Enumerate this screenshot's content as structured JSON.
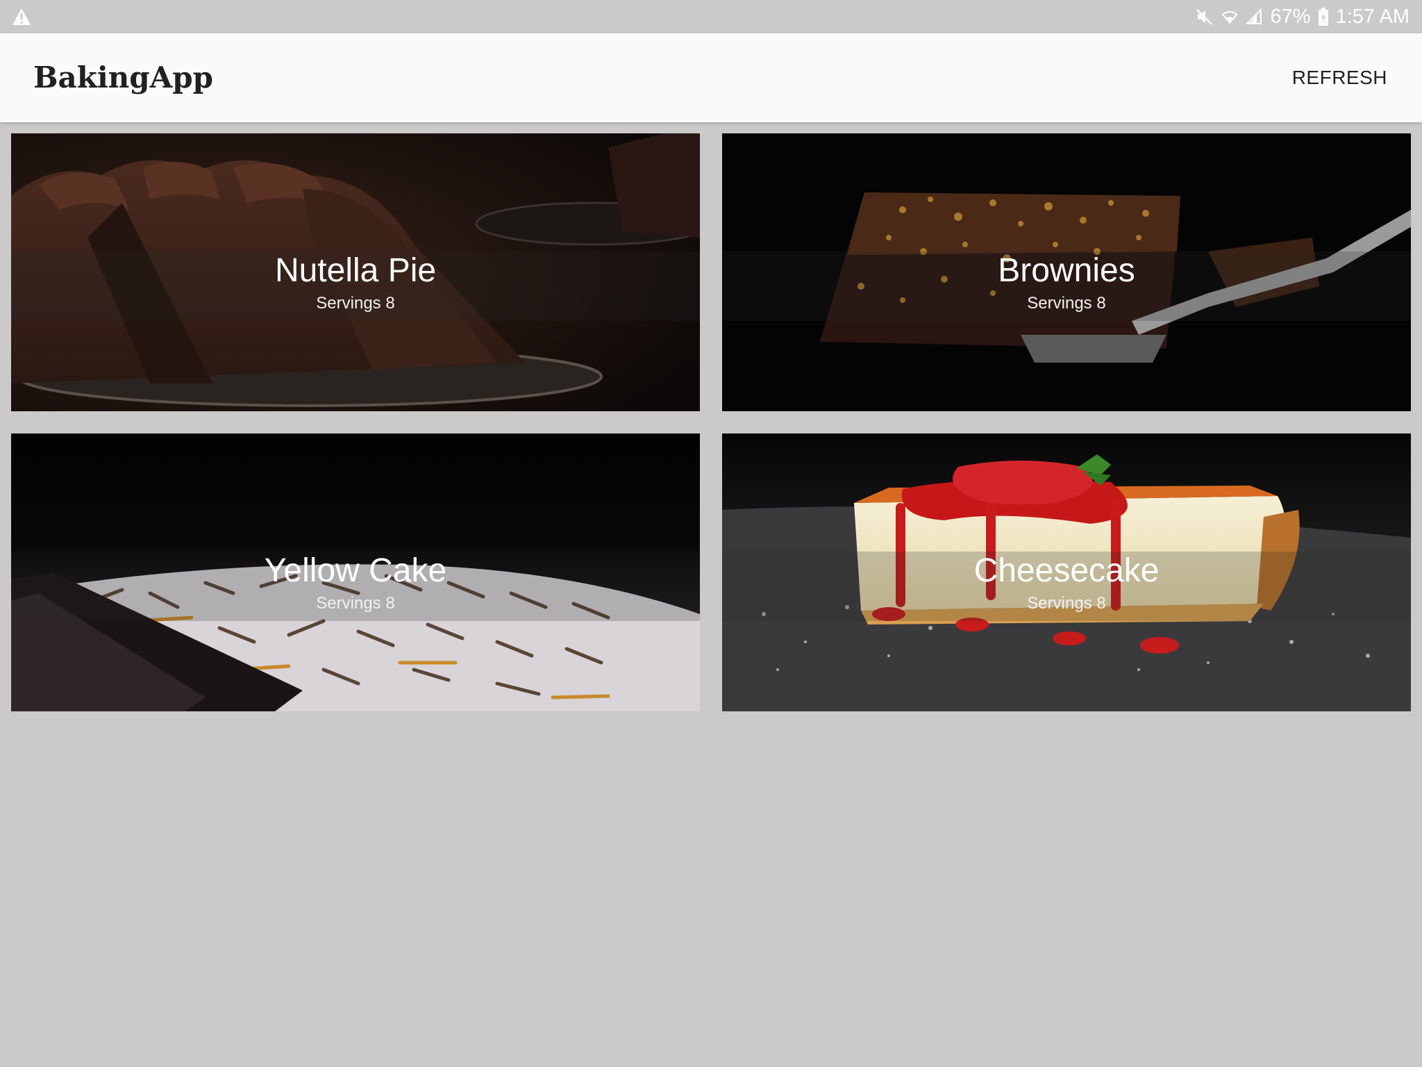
{
  "status_bar": {
    "battery": "67%",
    "time": "1:57 AM",
    "icons": [
      "warning-icon",
      "mute-icon",
      "wifi-icon",
      "signal-icon",
      "battery-charging-icon"
    ]
  },
  "app_bar": {
    "title": "BakingApp",
    "refresh_label": "REFRESH",
    "background": "#fafafa"
  },
  "recipes": [
    {
      "name": "Nutella Pie",
      "servings": "Servings 8"
    },
    {
      "name": "Brownies",
      "servings": "Servings 8"
    },
    {
      "name": "Yellow Cake",
      "servings": "Servings 8"
    },
    {
      "name": "Cheesecake",
      "servings": "Servings 8"
    }
  ],
  "colors": {
    "page_background": "#cbc9ca",
    "text_dark": "#212121",
    "text_light": "#ffffff"
  }
}
